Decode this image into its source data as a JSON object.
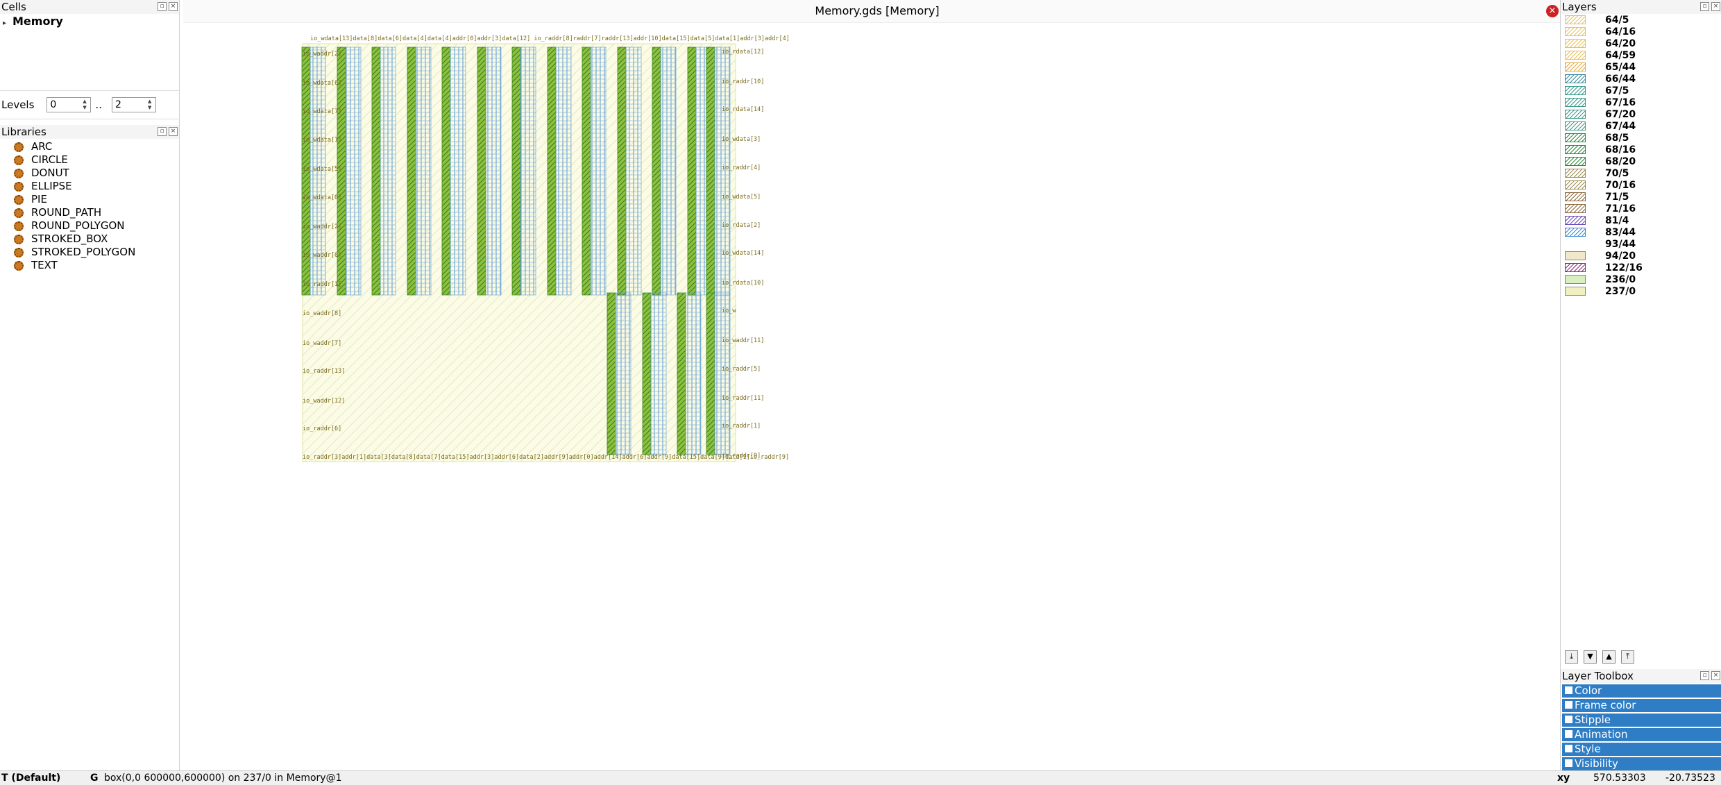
{
  "cells": {
    "title": "Cells",
    "items": [
      {
        "label": "Memory"
      }
    ]
  },
  "levels": {
    "label": "Levels",
    "from": "0",
    "sep": "..",
    "to": "2"
  },
  "libraries": {
    "title": "Libraries",
    "items": [
      "ARC",
      "CIRCLE",
      "DONUT",
      "ELLIPSE",
      "PIE",
      "ROUND_PATH",
      "ROUND_POLYGON",
      "STROKED_BOX",
      "STROKED_POLYGON",
      "TEXT"
    ]
  },
  "view": {
    "title": "Memory.gds [Memory]",
    "top_labels": "io_wdata[13]data[8]data[6]data[4]data[4]addr[0]addr[3]data[12]  io_raddr[8]raddr[7]raddr[13]addr[10]data[15]data[5]data[1]addr[3]addr[4]",
    "bottom_labels": "io_raddr[3]addr[1]data[3]data[8]data[7]data[15]addr[3]addr[6]data[2]addr[9]addr[0]addr[14]addr[6]addr[9]data[15]data[9]data[1]io_raddr[9]",
    "left_labels_top": [
      "io_waddr[2]",
      "io_wdata[6]",
      "io_wdata[7]",
      "io_wdata[1]",
      "io_wdata[5]",
      "io_wdata[0]",
      "io_waddr[2]",
      "io_waddr[0]",
      "io_raddr[1]"
    ],
    "left_labels_bottom": [
      "io_waddr[8]",
      "io_waddr[7]",
      "io_raddr[13]",
      "io_waddr[12]",
      "io_raddr[6]"
    ],
    "right_labels": [
      "io_rdata[12]",
      "io_raddr[10]",
      "io_rdata[14]",
      "io_wdata[3]",
      "io_raddr[4]",
      "io_wdata[5]",
      "io_rdata[2]",
      "io_wdata[14]",
      "io_rdata[10]",
      "io_w",
      "io_waddr[11]",
      "io_raddr[5]",
      "io_raddr[11]",
      "io_raddr[1]",
      "io_raddr[9]"
    ]
  },
  "layers": {
    "title": "Layers",
    "items": [
      {
        "name": "64/5",
        "color": "#e8c060",
        "fill": "hatch"
      },
      {
        "name": "64/16",
        "color": "#e8c060",
        "fill": "hatch"
      },
      {
        "name": "64/20",
        "color": "#e8c060",
        "fill": "hatch"
      },
      {
        "name": "64/59",
        "color": "#e8c060",
        "fill": "hatch"
      },
      {
        "name": "65/44",
        "color": "#e0a848",
        "fill": "hatch"
      },
      {
        "name": "66/44",
        "color": "#3a8a9a",
        "fill": "hatch"
      },
      {
        "name": "67/5",
        "color": "#3a9a8a",
        "fill": "hatch"
      },
      {
        "name": "67/16",
        "color": "#3a9a8a",
        "fill": "hatch"
      },
      {
        "name": "67/20",
        "color": "#3a9a8a",
        "fill": "hatch"
      },
      {
        "name": "67/44",
        "color": "#3a9a8a",
        "fill": "hatch"
      },
      {
        "name": "68/5",
        "color": "#2e8a3a",
        "fill": "hatch"
      },
      {
        "name": "68/16",
        "color": "#2e8a3a",
        "fill": "hatch"
      },
      {
        "name": "68/20",
        "color": "#2e8a3a",
        "fill": "hatch"
      },
      {
        "name": "70/5",
        "color": "#9a8a50",
        "fill": "hatch"
      },
      {
        "name": "70/16",
        "color": "#9a8a50",
        "fill": "hatch"
      },
      {
        "name": "71/5",
        "color": "#8a6a40",
        "fill": "hatch"
      },
      {
        "name": "71/16",
        "color": "#8a6a40",
        "fill": "hatch"
      },
      {
        "name": "81/4",
        "color": "#6a4ac0",
        "fill": "hatch"
      },
      {
        "name": "83/44",
        "color": "#3a8ad0",
        "fill": "hatch"
      },
      {
        "name": "93/44",
        "color": "#ffffff",
        "fill": "none"
      },
      {
        "name": "94/20",
        "color": "#f0e8c8",
        "fill": "solid"
      },
      {
        "name": "122/16",
        "color": "#8a2a7a",
        "fill": "hatch"
      },
      {
        "name": "236/0",
        "color": "#d8f0c0",
        "fill": "solid"
      },
      {
        "name": "237/0",
        "color": "#f0f0c0",
        "fill": "solid"
      }
    ]
  },
  "layer_toolbox": {
    "title": "Layer Toolbox",
    "items": [
      "Color",
      "Frame color",
      "Stipple",
      "Animation",
      "Style",
      "Visibility"
    ]
  },
  "status": {
    "mode": "T (Default)",
    "grid_key": "G",
    "message": "box(0,0 600000,600000) on 237/0 in Memory@1",
    "coord_label": "xy",
    "x": "570.53303",
    "y": "-20.73523"
  }
}
